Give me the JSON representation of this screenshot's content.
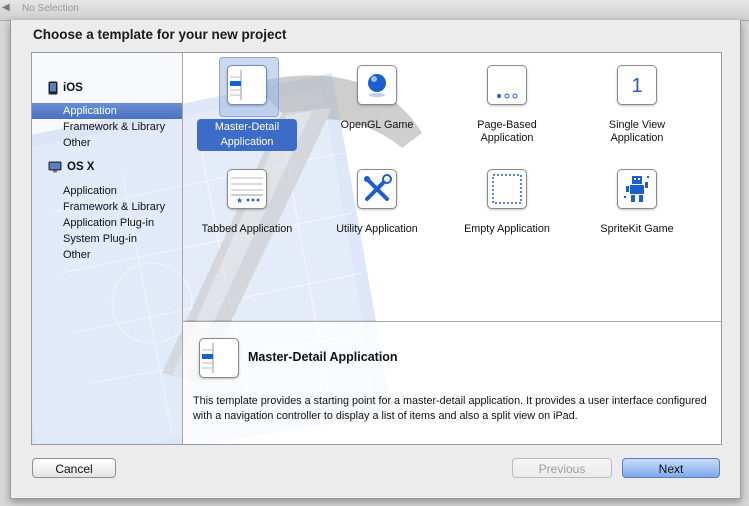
{
  "window": {
    "title": "No Selection"
  },
  "sheet": {
    "heading": "Choose a template for your new project"
  },
  "sidebar": {
    "sections": [
      {
        "name": "iOS",
        "items": [
          "Application",
          "Framework & Library",
          "Other"
        ]
      },
      {
        "name": "OS X",
        "items": [
          "Application",
          "Framework & Library",
          "Application Plug-in",
          "System Plug-in",
          "Other"
        ]
      }
    ],
    "selected": "iOS / Application"
  },
  "templates": [
    {
      "name": "Master-Detail Application",
      "line1": "Master-Detail",
      "line2": "Application",
      "icon": "master-detail-icon",
      "selected": true
    },
    {
      "name": "OpenGL Game",
      "line1": "OpenGL Game",
      "line2": "",
      "icon": "opengl-sphere-icon"
    },
    {
      "name": "Page-Based Application",
      "line1": "Page-Based",
      "line2": "Application",
      "icon": "page-dots-icon"
    },
    {
      "name": "Single View Application",
      "line1": "Single View",
      "line2": "Application",
      "icon": "single-view-1-icon"
    },
    {
      "name": "Tabbed Application",
      "line1": "Tabbed Application",
      "line2": "",
      "icon": "tabbed-icon"
    },
    {
      "name": "Utility Application",
      "line1": "Utility Application",
      "line2": "",
      "icon": "utility-tools-icon"
    },
    {
      "name": "Empty Application",
      "line1": "Empty Application",
      "line2": "",
      "icon": "empty-dashed-icon"
    },
    {
      "name": "SpriteKit Game",
      "line1": "SpriteKit Game",
      "line2": "",
      "icon": "spritekit-robot-icon"
    }
  ],
  "detail": {
    "title": "Master-Detail Application",
    "description": "This template provides a starting point for a master-detail application. It provides a user interface configured with a navigation controller to display a list of items and also a split view on iPad."
  },
  "buttons": {
    "cancel": "Cancel",
    "previous": "Previous",
    "next": "Next"
  },
  "colors": {
    "selection": "#3d6cc8",
    "accent_blue": "#1a5fd0",
    "default_button": "#7ea9ea"
  }
}
